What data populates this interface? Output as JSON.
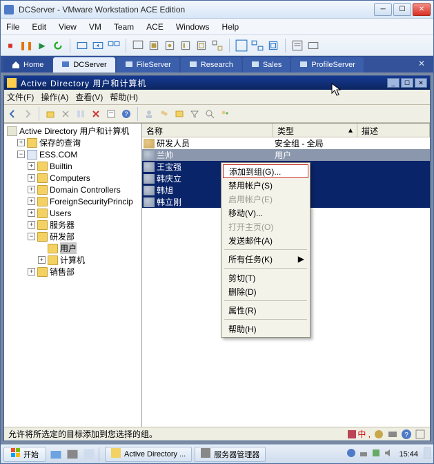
{
  "vmware": {
    "title": "DCServer - VMware Workstation ACE Edition",
    "menu": {
      "file": "File",
      "edit": "Edit",
      "view": "View",
      "vm": "VM",
      "team": "Team",
      "ace": "ACE",
      "windows": "Windows",
      "help": "Help"
    },
    "tabs": {
      "home": "Home",
      "dcserver": "DCServer",
      "fileserver": "FileServer",
      "research": "Research",
      "sales": "Sales",
      "profileserver": "ProfileServer"
    }
  },
  "mmc": {
    "title": "Active Directory 用户和计算机",
    "menu": {
      "file": "文件(F)",
      "action": "操作(A)",
      "view": "查看(V)",
      "help": "帮助(H)"
    },
    "tree": {
      "root": "Active Directory 用户和计算机",
      "saved_queries": "保存的查询",
      "domain": "ESS.COM",
      "builtin": "Builtin",
      "computers": "Computers",
      "domain_controllers": "Domain Controllers",
      "fsp": "ForeignSecurityPrincip",
      "users_en": "Users",
      "servers": "服务器",
      "rnd_dept": "研发部",
      "rnd_users": "用户",
      "rnd_computers": "计算机",
      "sales_dept": "销售部"
    },
    "columns": {
      "name": "名称",
      "type": "类型",
      "desc": "描述"
    },
    "rows": [
      {
        "name": "研发人员",
        "type": "安全组 - 全局",
        "kind": "group",
        "sel": false
      },
      {
        "name": "兰帅",
        "type": "用户",
        "kind": "user",
        "sel": true
      },
      {
        "name": "王宝强",
        "type": "",
        "kind": "user",
        "sel": true
      },
      {
        "name": "韩庆立",
        "type": "",
        "kind": "user",
        "sel": true
      },
      {
        "name": "韩旭",
        "type": "",
        "kind": "user",
        "sel": true
      },
      {
        "name": "韩立刚",
        "type": "",
        "kind": "user",
        "sel": true
      }
    ],
    "context_menu": {
      "add_to_group": "添加到组(G)...",
      "disable_acct": "禁用帐户(S)",
      "enable_acct": "启用帐户(E)",
      "move": "移动(V)...",
      "open_home": "打开主页(O)",
      "send_mail": "发送邮件(A)",
      "all_tasks": "所有任务(K)",
      "cut": "剪切(T)",
      "delete": "删除(D)",
      "properties": "属性(R)",
      "help": "帮助(H)"
    },
    "status": "允许将所选定的目标添加到您选择的组。",
    "status_text": "中 ,"
  },
  "taskbar": {
    "start": "开始",
    "task_ad": "Active Directory ...",
    "task_srvmgr": "服务器管理器",
    "clock": "15:44"
  }
}
